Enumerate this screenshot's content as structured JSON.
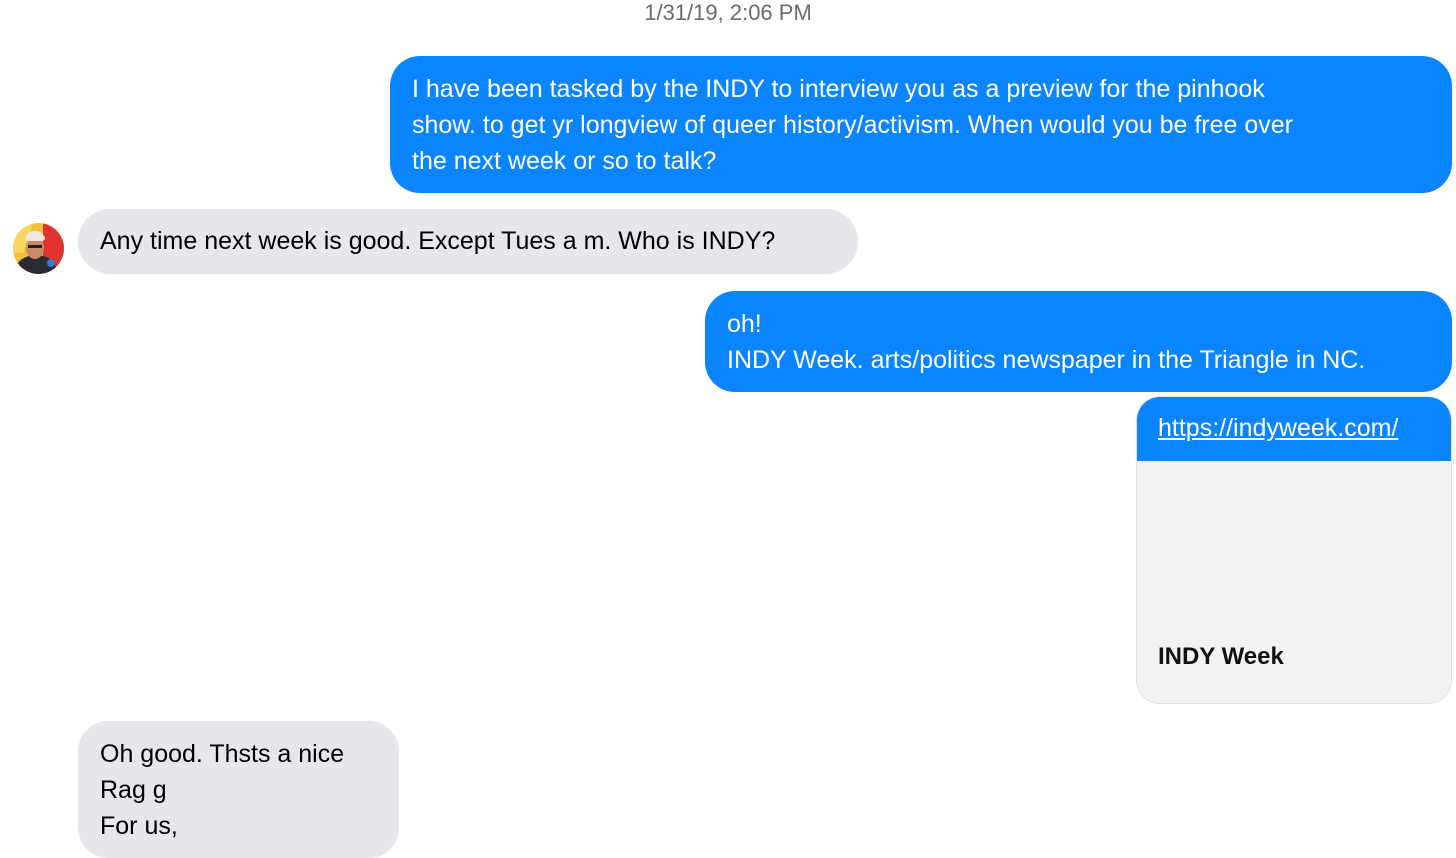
{
  "timestamp": "1/31/19, 2:06 PM",
  "colors": {
    "outgoing_bubble": "#0a84ff",
    "incoming_bubble": "#e6e7ea",
    "link_preview_background": "#f2f2f2"
  },
  "avatar": {
    "icon": "contact-avatar-photo"
  },
  "messages": [
    {
      "direction": "outgoing",
      "text": "I have been tasked by the INDY to interview you as a preview for the pinhook\nshow. to get yr longview of queer history/activism. When would you be free over\nthe next week or so to talk?"
    },
    {
      "direction": "incoming",
      "text": "Any time next week is good. Except Tues a m. Who is INDY?"
    },
    {
      "direction": "outgoing",
      "text": "oh!\nINDY Week. arts/politics newspaper in the Triangle in NC."
    },
    {
      "direction": "outgoing",
      "type": "link",
      "url": "https://indyweek.com/",
      "preview_title": "INDY Week"
    },
    {
      "direction": "incoming",
      "text": "Oh good. Thsts a nice\nRag g\nFor us,"
    }
  ]
}
